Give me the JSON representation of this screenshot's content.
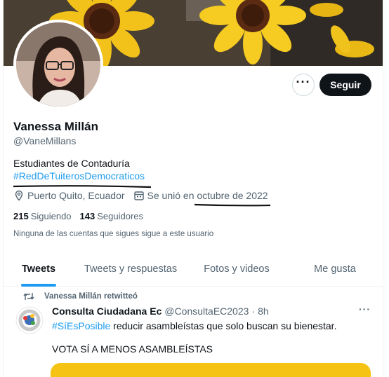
{
  "profile": {
    "name": "Vanessa Millán",
    "handle": "@VaneMillans",
    "bio_line1": "Estudiantes de Contaduría",
    "bio_hashtag": "#RedDeTuiterosDemocraticos",
    "location": "Puerto Quito, Ecuador",
    "joined_prefix": "Se unió en",
    "joined_date": "octubre de 2022",
    "following_count": "215",
    "following_label": "Siguiendo",
    "followers_count": "143",
    "followers_label": "Seguidores",
    "followers_note": "Ninguna de las cuentas que sigues sigue a este usuario"
  },
  "actions": {
    "more_label": "···",
    "follow_label": "Seguir"
  },
  "tabs": [
    {
      "label": "Tweets",
      "active": true
    },
    {
      "label": "Tweets y respuestas",
      "active": false
    },
    {
      "label": "Fotos y videos",
      "active": false
    },
    {
      "label": "Me gusta",
      "active": false
    }
  ],
  "tweet": {
    "retweet_text": "Vanessa Millán retwitteó",
    "author_name": "Consulta Ciudadana Ec",
    "author_handle": "@ConsultaEC2023",
    "separator": "·",
    "time": "8h",
    "more_label": "···",
    "hashtag": "#SíEsPosible",
    "text_rest": " reducir asambleístas que solo buscan su bienestar.",
    "text_line2": "VOTA SÍ A MENOS ASAMBLEÍSTAS"
  },
  "colors": {
    "accent": "#1d9bf0",
    "text_primary": "#0f1419",
    "text_secondary": "#536471",
    "card_yellow": "#f5c314"
  }
}
